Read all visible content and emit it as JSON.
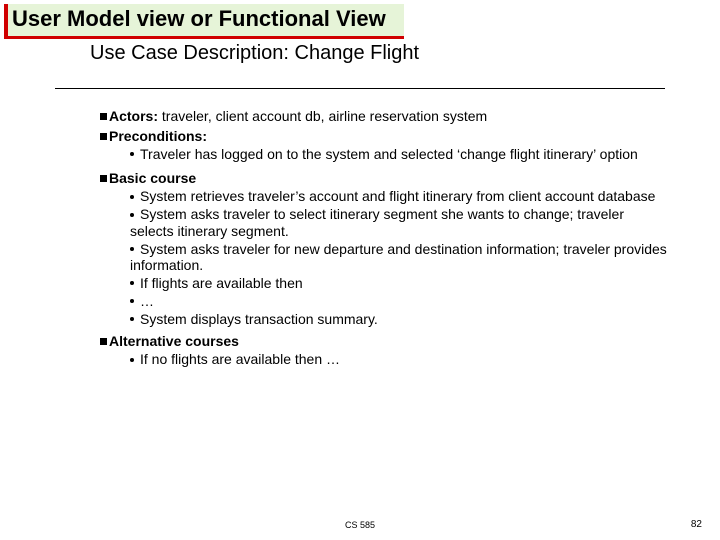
{
  "title": "User Model view or Functional View",
  "subtitle": "Use Case Description: Change Flight",
  "sections": {
    "actors": {
      "label": "Actors:",
      "text": " traveler, client account db, airline reservation system"
    },
    "preconditions": {
      "label": "Preconditions:",
      "items": [
        "Traveler has logged on to the system and selected ‘change flight itinerary’ option"
      ]
    },
    "basic": {
      "label": "Basic course",
      "items": [
        "System retrieves traveler’s account and flight itinerary from client account database",
        "System asks traveler to select itinerary segment she wants to change; traveler selects itinerary segment.",
        "System asks traveler for new departure and destination information; traveler provides information.",
        "If flights are available then",
        "…",
        "System displays transaction summary."
      ]
    },
    "alternative": {
      "label": "Alternative courses",
      "items": [
        "If no flights are available then …"
      ]
    }
  },
  "footer": {
    "course": "CS 585",
    "page": "82"
  }
}
